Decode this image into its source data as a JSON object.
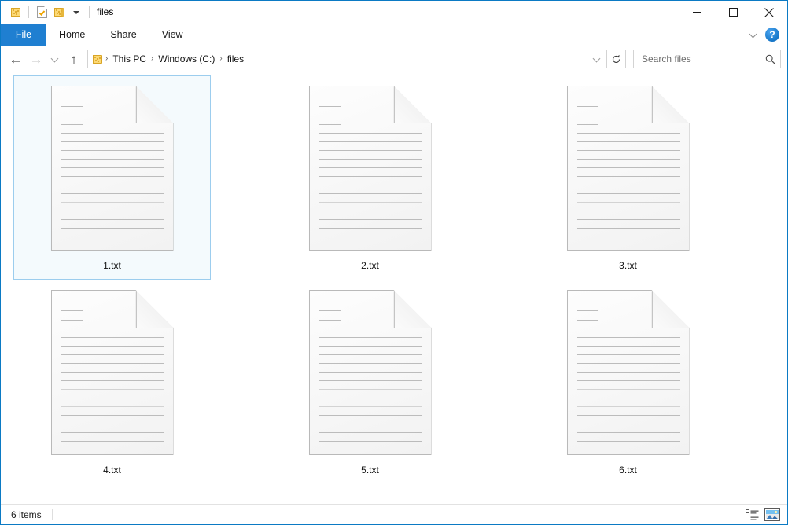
{
  "window": {
    "title": "files",
    "border_color": "#0b7ac4",
    "accent_color": "#1f7fd1"
  },
  "quick_access": {
    "pin_icon": "folder-pin-icon",
    "properties_icon": "properties-icon",
    "new_folder_icon": "new-folder-icon",
    "customize_icon": "chevron-down-icon"
  },
  "window_controls": {
    "minimize": "minimize-icon",
    "maximize": "maximize-icon",
    "close": "close-icon"
  },
  "ribbon": {
    "tabs": [
      {
        "label": "File",
        "active": true
      },
      {
        "label": "Home",
        "active": false
      },
      {
        "label": "Share",
        "active": false
      },
      {
        "label": "View",
        "active": false
      }
    ],
    "collapse_icon": "chevron-down-icon",
    "help_label": "?"
  },
  "address": {
    "back_icon": "back-arrow-icon",
    "forward_icon": "forward-arrow-icon",
    "recent_icon": "chevron-down-icon",
    "up_icon": "up-arrow-icon",
    "folder_icon": "folder-icon",
    "breadcrumbs": [
      "This PC",
      "Windows (C:)",
      "files"
    ],
    "separator": "›",
    "dropdown_icon": "chevron-down-icon",
    "refresh_icon": "refresh-icon"
  },
  "search": {
    "placeholder": "Search files",
    "value": "",
    "icon": "search-icon"
  },
  "files": [
    {
      "name": "1.txt",
      "type": "text-file",
      "selected": true
    },
    {
      "name": "2.txt",
      "type": "text-file",
      "selected": false
    },
    {
      "name": "3.txt",
      "type": "text-file",
      "selected": false
    },
    {
      "name": "4.txt",
      "type": "text-file",
      "selected": false
    },
    {
      "name": "5.txt",
      "type": "text-file",
      "selected": false
    },
    {
      "name": "6.txt",
      "type": "text-file",
      "selected": false
    }
  ],
  "status": {
    "items_text": "6 items",
    "details_view_icon": "details-view-icon",
    "large_icons_view_icon": "large-icons-view-icon",
    "active_view": "large-icons-view-icon"
  }
}
